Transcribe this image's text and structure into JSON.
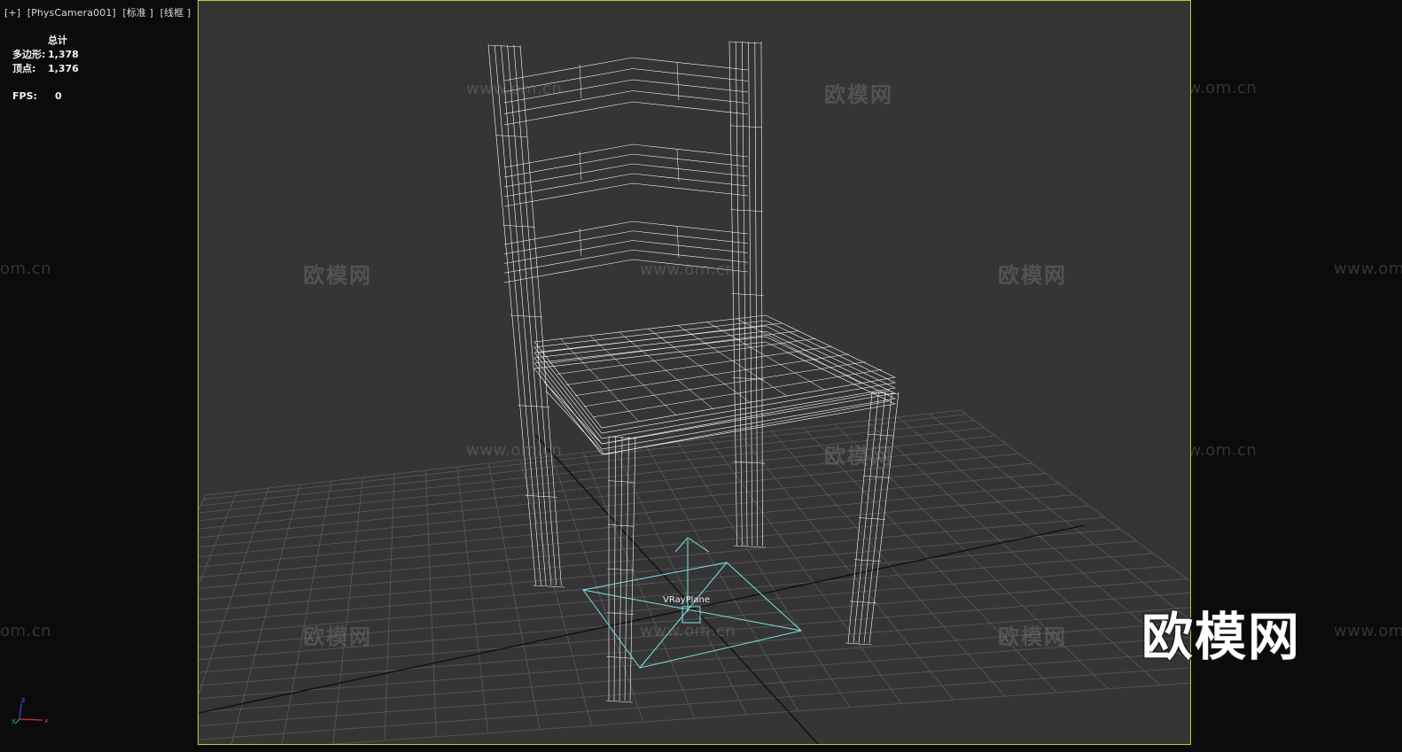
{
  "viewport": {
    "menu": {
      "plus": "[+]",
      "camera": "[PhysCamera001]",
      "shading": "[标准 ]",
      "mode": "[线框 ]"
    },
    "stats": {
      "header": "总计",
      "polygons_label": "多边形:",
      "polygons_value": "1,378",
      "vertices_label": "顶点:",
      "vertices_value": "1,376",
      "fps_label": "FPS:",
      "fps_value": "0"
    },
    "object_label": "VRayPlane",
    "watermark_text": "欧模网",
    "watermark_url": "www.om.cn",
    "watermark_url_partial": "om.cn",
    "brand_logo": "欧模网",
    "axis_labels": {
      "x": "x",
      "y": "y",
      "z": "z"
    }
  },
  "colors": {
    "viewport_bg": "#353535",
    "outer_bg": "#0b0b0b",
    "safe_frame": "#c9c537",
    "wireframe": "#ffffff",
    "grid": "#5a5a5a",
    "grid_axis": "#101010",
    "gizmo": "#7fe0e8"
  }
}
